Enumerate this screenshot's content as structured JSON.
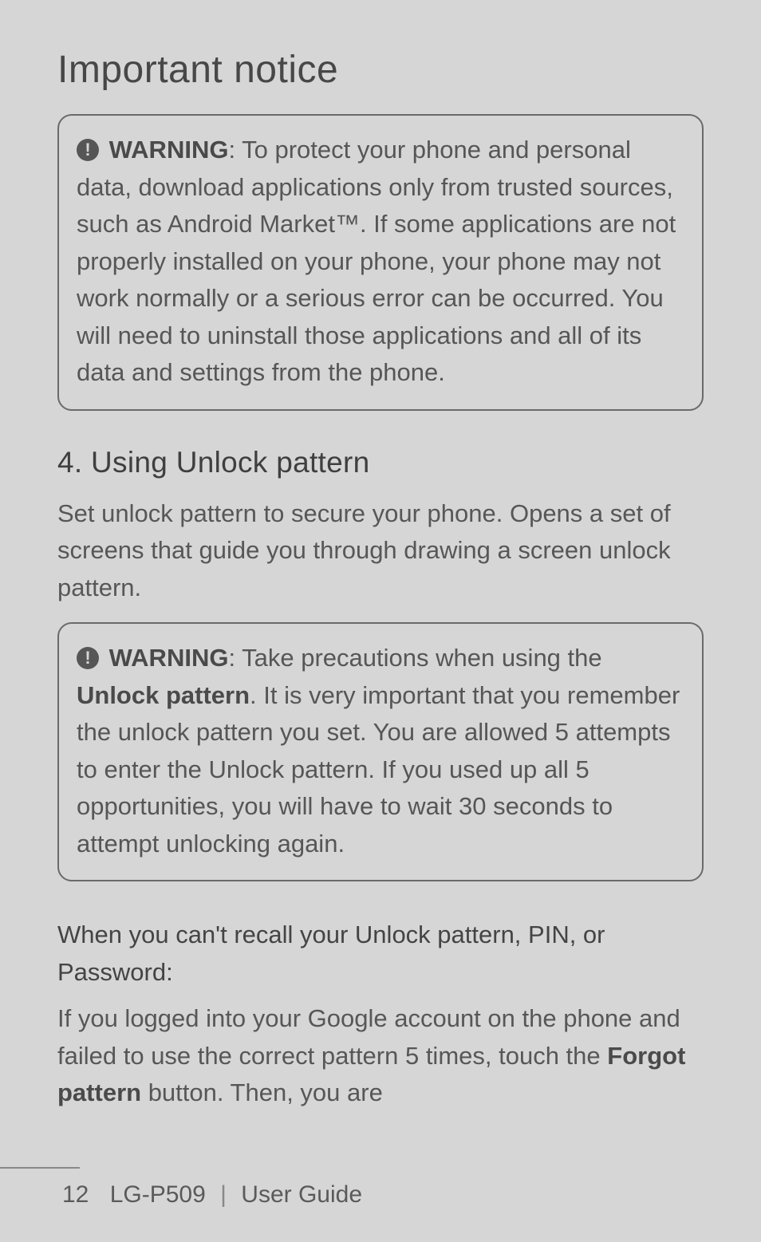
{
  "page": {
    "title": "Important notice",
    "page_number": "12",
    "footer_product": "LG-P509",
    "footer_doc": "User Guide"
  },
  "warning1": {
    "label": "WARNING",
    "text": ": To protect your phone and personal data, download applications only from trusted sources, such as Android Market™. If some applications are not properly installed on your phone, your phone may not work normally or a serious error can be occurred. You will need to uninstall those applications and all of its data and settings from the phone."
  },
  "section4": {
    "heading": "4. Using Unlock pattern",
    "intro": "Set unlock pattern to secure your phone. Opens a set of screens that guide you through drawing a screen unlock pattern."
  },
  "warning2": {
    "label": "WARNING",
    "pre": ": Take precautions when using the ",
    "bold": "Unlock pattern",
    "post": ". It is very important that you remember the unlock pattern you set. You are allowed 5 attempts to enter the Unlock pattern. If you used up all 5 opportunities, you will have to wait 30 seconds to attempt unlocking again."
  },
  "recall": {
    "heading": "When you can't recall your Unlock pattern, PIN, or Password:",
    "pre": "If you logged into your Google account on the phone and failed to use the correct pattern 5 times, touch the ",
    "bold": "Forgot pattern",
    "post": " button. Then, you are"
  }
}
